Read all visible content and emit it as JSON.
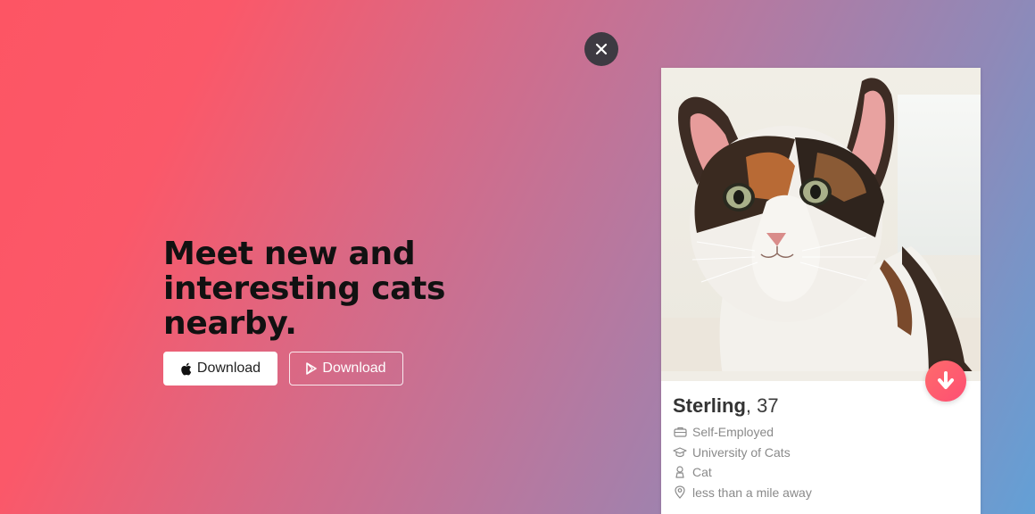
{
  "hero": {
    "title": "Meet new and interesting cats nearby."
  },
  "buttons": {
    "apple_download": {
      "label": "Download",
      "icon": "apple-icon"
    },
    "play_download": {
      "label": "Download",
      "icon": "play-store-icon"
    }
  },
  "close": {
    "icon": "close-icon"
  },
  "profile": {
    "name": "Sterling",
    "age_text": ", 37",
    "job": "Self-Employed",
    "school": "University of Cats",
    "gender": "Cat",
    "distance": "less than a mile away",
    "photo": "calico-cat-photo"
  },
  "colors": {
    "gradient_start": "#fd5564",
    "gradient_end": "#63a0d6",
    "close_bg": "#3d3a42",
    "fab_accent": "#fd4f73"
  }
}
